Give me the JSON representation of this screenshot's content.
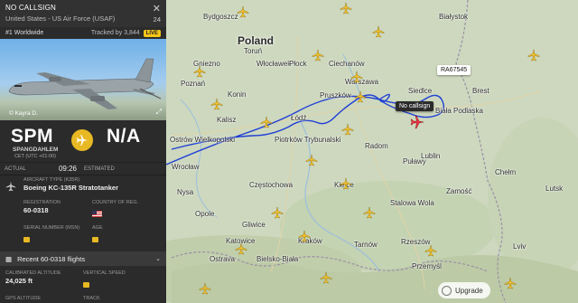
{
  "flight": {
    "callsign": "NO CALLSIGN",
    "operator": "United States - US Air Force (USAF)",
    "count": "24",
    "rank": "#1 Worldwide",
    "tracked": "Tracked by 3,844",
    "live": "LIVE",
    "photo_credit": "© Kayra D."
  },
  "route": {
    "from_code": "SPM",
    "from_name": "SPANGDAHLEM",
    "from_tz": "CET (UTC +01:00)",
    "to_code": "N/A"
  },
  "times": {
    "actual_label": "ACTUAL",
    "actual_value": "09:26",
    "estimated_label": "ESTIMATED"
  },
  "aircraft": {
    "type_label": "AIRCRAFT TYPE",
    "type_code": "(K35R)",
    "type_value": "Boeing KC-135R Stratotanker",
    "reg_label": "REGISTRATION",
    "reg_value": "60-0318",
    "country_label": "COUNTRY OF REG.",
    "serial_label": "SERIAL NUMBER (MSN)",
    "age_label": "AGE"
  },
  "recent": {
    "label": "Recent 60-0318 flights"
  },
  "stats": {
    "alt_label": "CALIBRATED ALTITUDE",
    "alt_value": "24,025 ft",
    "vs_label": "VERTICAL SPEED",
    "gps_label": "GPS ALTITUDE",
    "track_label": "TRACK"
  },
  "map": {
    "countries": {
      "poland": "Poland"
    },
    "cities": {
      "bydgoszcz": "Bydgoszcz",
      "bialystok": "Białystok",
      "torun": "Toruń",
      "gniezno": "Gniezno",
      "wloclawek": "Włocławek",
      "plock": "Płock",
      "ciechanow": "Ciechanów",
      "poznan": "Poznań",
      "konin": "Konin",
      "pruszkow": "Pruszków",
      "warszawa": "Warszawa",
      "siedlce": "Siedlce",
      "brest": "Brest",
      "biala": "Biała Podlaska",
      "kalisz": "Kalisz",
      "lodz": "Łódź",
      "ostrow": "Ostrów Wielkopolski",
      "piotrkow": "Piotrków Trybunalski",
      "radom": "Radom",
      "pulawy": "Puławy",
      "lublin": "Lublin",
      "wroclaw": "Wrocław",
      "czestochowa": "Częstochowa",
      "kielce": "Kielce",
      "lutsk": "Lutsk",
      "chelm": "Chełm",
      "opole": "Opole",
      "gliwice": "Gliwice",
      "katowice": "Katowice",
      "krakow": "Kraków",
      "tarnow": "Tarnów",
      "rzeszow": "Rzeszów",
      "stalowa": "Stalowa Wola",
      "zamosc": "Zamość",
      "ostrava": "Ostrava",
      "bielsko": "Bielsko-Biała",
      "przemysl": "Przemyśl",
      "lviv": "Lviv",
      "nysa": "Nysa"
    },
    "tags": {
      "ra": "RA67545",
      "no_callsign": "No callsign"
    },
    "upgrade": "Upgrade"
  },
  "colors": {
    "track": "#1f3fd6",
    "accent": "#e8b923",
    "selected_plane": "#e63946"
  }
}
